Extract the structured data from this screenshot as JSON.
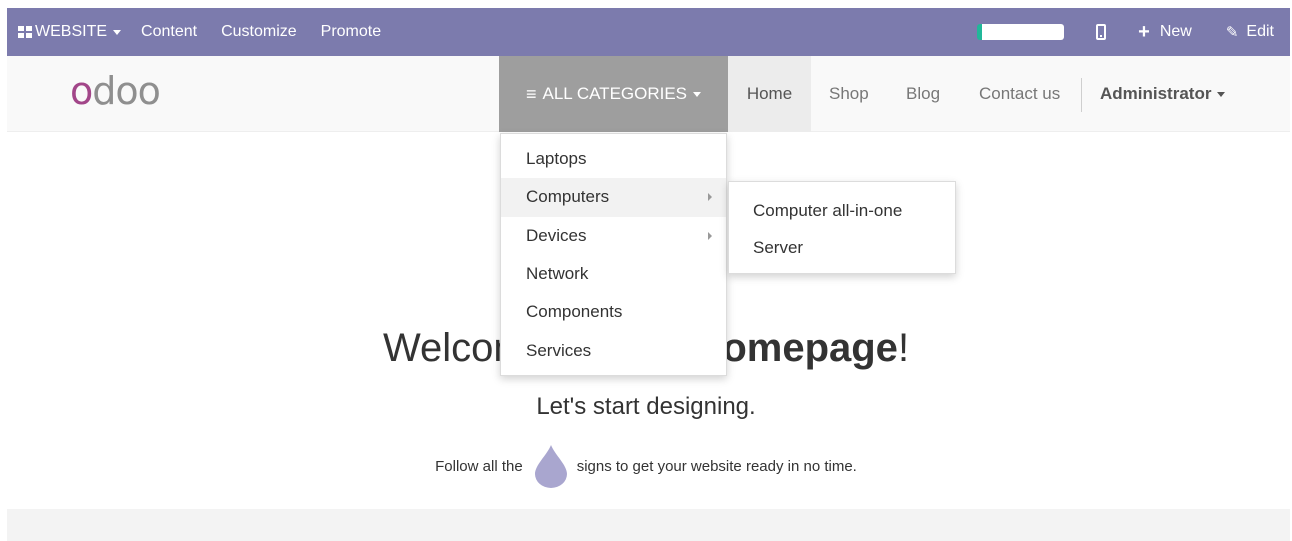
{
  "admin_bar": {
    "website_label": "WEBSITE",
    "content_label": "Content",
    "customize_label": "Customize",
    "promote_label": "Promote",
    "new_label": "New",
    "edit_label": "Edit",
    "background_color": "#7c7bad"
  },
  "navbar": {
    "logo_text": "odoo",
    "categories_label": "ALL CATEGORIES",
    "links": {
      "home": "Home",
      "shop": "Shop",
      "blog": "Blog",
      "contact": "Contact us"
    },
    "user_label": "Administrator"
  },
  "categories_menu": {
    "items": [
      "Laptops",
      "Computers",
      "Devices",
      "Network",
      "Components",
      "Services"
    ],
    "active_item": "Computers"
  },
  "submenu": {
    "items": [
      "Computer all-in-one",
      "Server"
    ]
  },
  "hero": {
    "welcome_prefix": "Welcome to your ",
    "welcome_bold": "Homepage",
    "welcome_suffix": "!",
    "subtitle": "Let's start designing.",
    "follow_before": "Follow all the",
    "follow_after": "signs to get your website ready in no time."
  },
  "colors": {
    "brand_purple": "#a24689",
    "admin_purple": "#7c7bad",
    "drop_icon": "#a9a6cf",
    "progress_green": "#21b799"
  }
}
